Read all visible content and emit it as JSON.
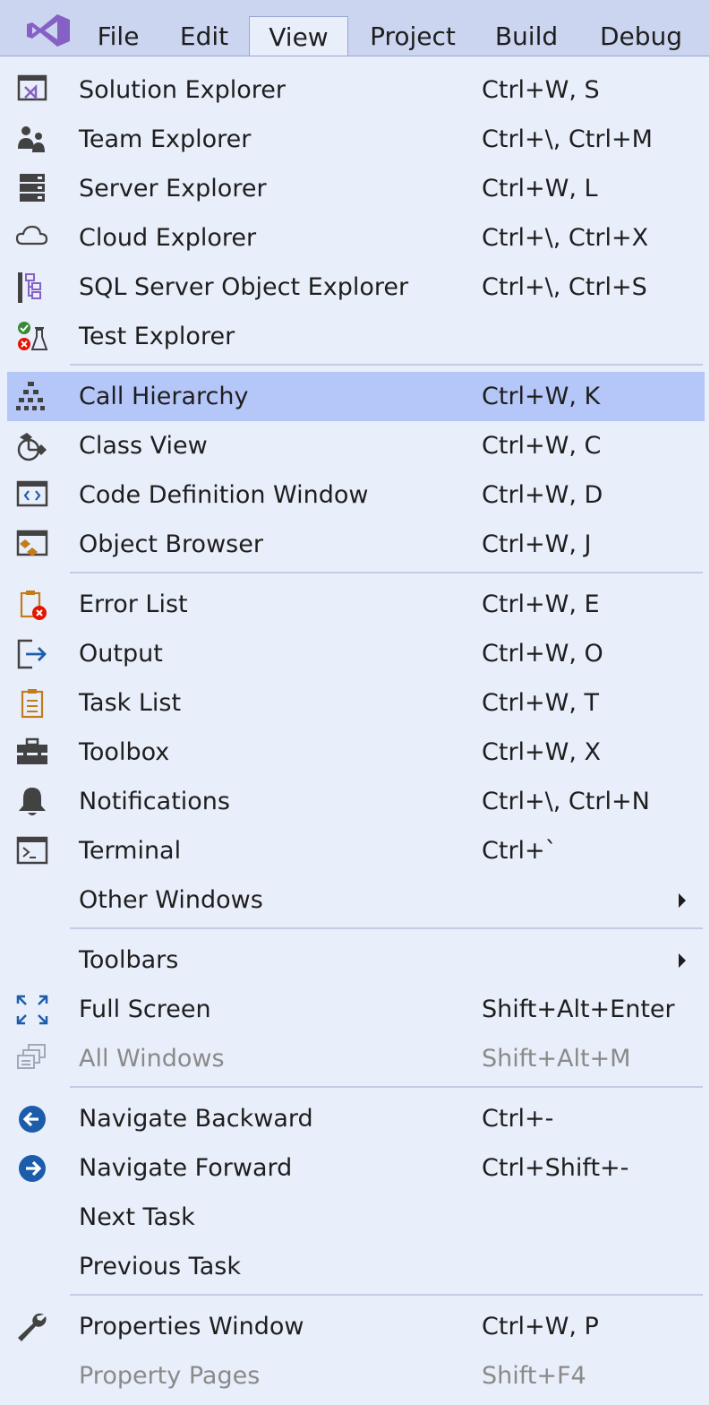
{
  "menubar": {
    "logo_icon": "visual-studio-logo-icon",
    "items": [
      {
        "label": "File"
      },
      {
        "label": "Edit"
      },
      {
        "label": "View",
        "active": true
      },
      {
        "label": "Project"
      },
      {
        "label": "Build"
      },
      {
        "label": "Debug"
      }
    ]
  },
  "view_menu": {
    "groups": [
      [
        {
          "label": "Solution Explorer",
          "shortcut": "Ctrl+W, S",
          "icon": "solution-explorer-icon"
        },
        {
          "label": "Team Explorer",
          "shortcut": "Ctrl+\\, Ctrl+M",
          "icon": "team-explorer-icon"
        },
        {
          "label": "Server Explorer",
          "shortcut": "Ctrl+W, L",
          "icon": "server-explorer-icon"
        },
        {
          "label": "Cloud Explorer",
          "shortcut": "Ctrl+\\, Ctrl+X",
          "icon": "cloud-icon"
        },
        {
          "label": "SQL Server Object Explorer",
          "shortcut": "Ctrl+\\, Ctrl+S",
          "icon": "sql-server-object-explorer-icon"
        },
        {
          "label": "Test Explorer",
          "shortcut": "",
          "icon": "test-explorer-icon"
        }
      ],
      [
        {
          "label": "Call Hierarchy",
          "shortcut": "Ctrl+W, K",
          "icon": "call-hierarchy-icon",
          "highlighted": true
        },
        {
          "label": "Class View",
          "shortcut": "Ctrl+W, C",
          "icon": "class-view-icon"
        },
        {
          "label": "Code Definition Window",
          "shortcut": "Ctrl+W, D",
          "icon": "code-definition-icon"
        },
        {
          "label": "Object Browser",
          "shortcut": "Ctrl+W, J",
          "icon": "object-browser-icon"
        }
      ],
      [
        {
          "label": "Error List",
          "shortcut": "Ctrl+W, E",
          "icon": "error-list-icon"
        },
        {
          "label": "Output",
          "shortcut": "Ctrl+W, O",
          "icon": "output-icon"
        },
        {
          "label": "Task List",
          "shortcut": "Ctrl+W, T",
          "icon": "task-list-icon"
        },
        {
          "label": "Toolbox",
          "shortcut": "Ctrl+W, X",
          "icon": "toolbox-icon"
        },
        {
          "label": "Notifications",
          "shortcut": "Ctrl+\\, Ctrl+N",
          "icon": "bell-icon"
        },
        {
          "label": "Terminal",
          "shortcut": "Ctrl+`",
          "icon": "terminal-icon"
        },
        {
          "label": "Other Windows",
          "shortcut": "",
          "icon": "",
          "submenu": true
        }
      ],
      [
        {
          "label": "Toolbars",
          "shortcut": "",
          "icon": "",
          "submenu": true
        },
        {
          "label": "Full Screen",
          "shortcut": "Shift+Alt+Enter",
          "icon": "full-screen-icon"
        },
        {
          "label": "All Windows",
          "shortcut": "Shift+Alt+M",
          "icon": "all-windows-icon",
          "disabled": true
        }
      ],
      [
        {
          "label": "Navigate Backward",
          "shortcut": "Ctrl+-",
          "icon": "navigate-backward-icon"
        },
        {
          "label": "Navigate Forward",
          "shortcut": "Ctrl+Shift+-",
          "icon": "navigate-forward-icon"
        },
        {
          "label": "Next Task",
          "shortcut": "",
          "icon": ""
        },
        {
          "label": "Previous Task",
          "shortcut": "",
          "icon": ""
        }
      ],
      [
        {
          "label": "Properties Window",
          "shortcut": "Ctrl+W, P",
          "icon": "wrench-icon"
        },
        {
          "label": "Property Pages",
          "shortcut": "Shift+F4",
          "icon": "",
          "disabled": true
        }
      ]
    ]
  },
  "colors": {
    "menubar_bg": "#ccd5f0",
    "menu_bg": "#e9eefb",
    "highlight_bg": "#b5c7f8",
    "vs_purple": "#8661c5",
    "icon_blue": "#1c5dab",
    "error_red": "#e51400"
  }
}
